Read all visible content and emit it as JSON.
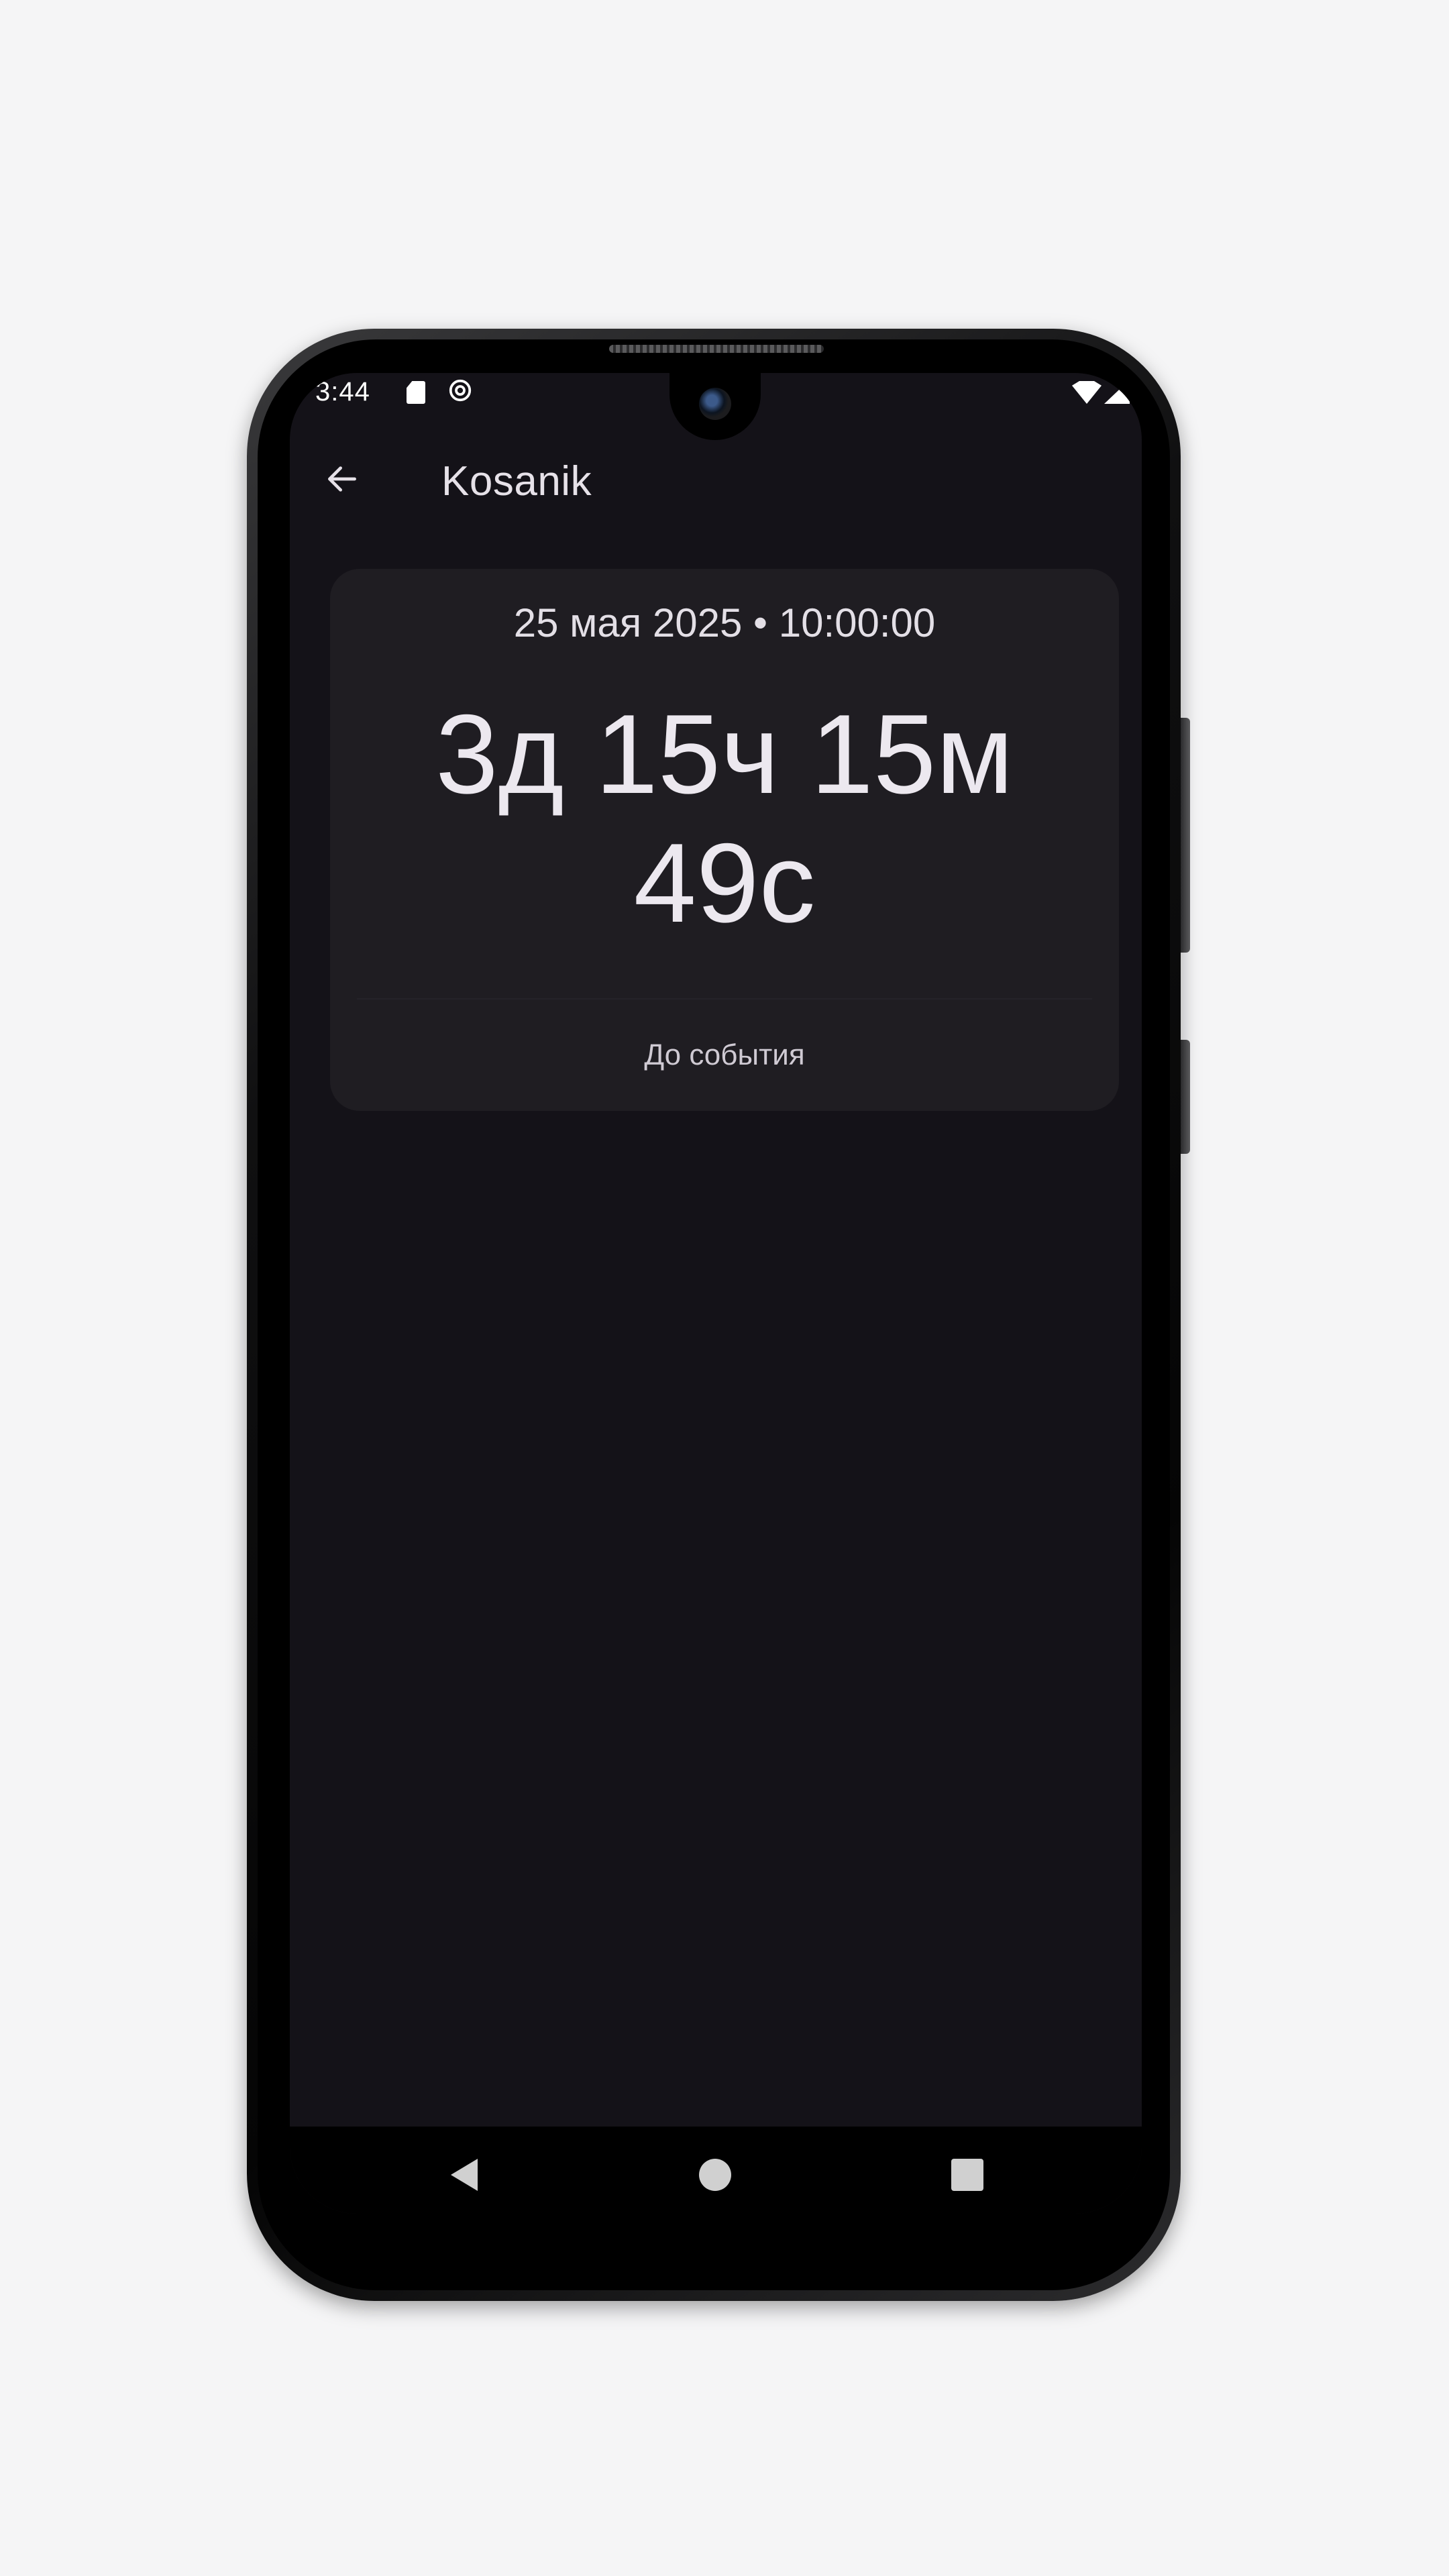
{
  "status_bar": {
    "time": "3:44"
  },
  "app_bar": {
    "title": "Kosanik"
  },
  "countdown": {
    "event_datetime": "25 мая 2025 • 10:00:00",
    "remaining": "3д 15ч 15м 49с",
    "caption": "До события"
  },
  "icons": {
    "back": "arrow-left-icon",
    "sd_card": "sd-card-icon",
    "at_sign": "at-sign-icon",
    "wifi": "wifi-icon",
    "signal": "signal-icon",
    "nav_back": "triangle-back-icon",
    "nav_home": "circle-home-icon",
    "nav_recents": "square-recents-icon"
  },
  "colors": {
    "screen_background": "#141218",
    "card_background": "#1f1d22",
    "text_primary": "#ece8ef"
  }
}
